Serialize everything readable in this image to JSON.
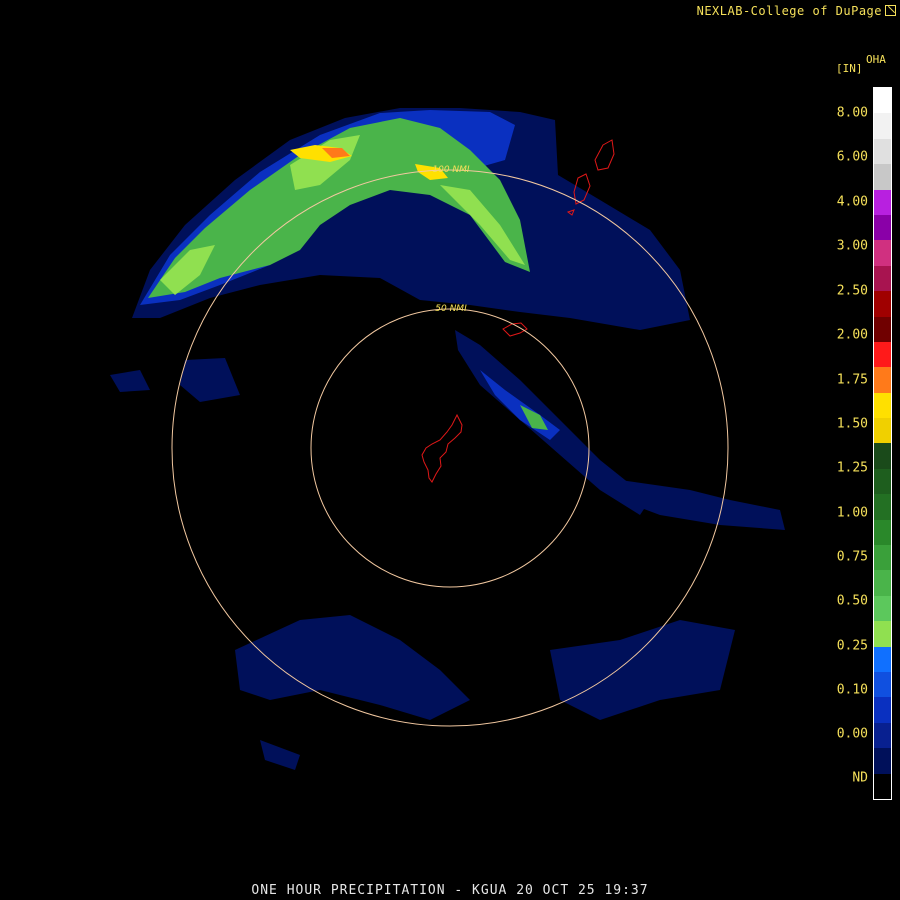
{
  "credit": "NEXLAB-College of DuPage",
  "legend": {
    "unit": "[IN]",
    "product": "OHA",
    "ticks": [
      "8.00",
      "6.00",
      "4.00",
      "3.00",
      "2.50",
      "2.00",
      "1.75",
      "1.50",
      "1.25",
      "1.00",
      "0.75",
      "0.50",
      "0.25",
      "0.10",
      "0.00",
      "ND"
    ],
    "colors": [
      "#ffffff",
      "#f2f2f2",
      "#e0e0e0",
      "#c8c8c8",
      "#b820e0",
      "#8a00a8",
      "#d03080",
      "#a81450",
      "#a00000",
      "#700000",
      "#ff1a1a",
      "#ff7a1a",
      "#ffe000",
      "#f0d000",
      "#1a4a1a",
      "#1e5e1e",
      "#237023",
      "#2a882a",
      "#3aa03a",
      "#4ab44a",
      "#5cc85c",
      "#90e050",
      "#1070ff",
      "#1050e0",
      "#0a30c0",
      "#082090",
      "#00105a",
      "#000000"
    ]
  },
  "rings": [
    {
      "label": "50 NMI"
    },
    {
      "label": "100 NMI"
    }
  ],
  "footer": "ONE HOUR PRECIPITATION - KGUA 20 OCT 25 19:37",
  "colors": {
    "background": "#000000",
    "text": "#f5e05a",
    "ring": "#f2c8a0",
    "coastline": "#e01818"
  }
}
